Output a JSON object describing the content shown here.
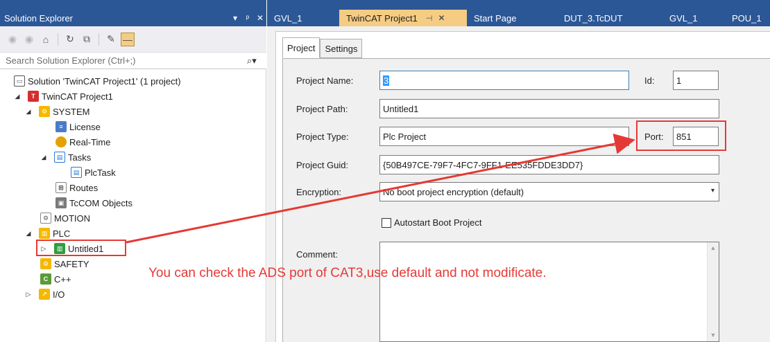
{
  "solution_explorer": {
    "title": "Solution Explorer",
    "title_buttons": [
      "▾",
      "ᵖ",
      "✕"
    ],
    "search_placeholder": "Search Solution Explorer (Ctrl+;)",
    "tree": {
      "solution": "Solution 'TwinCAT Project1' (1 project)",
      "project": "TwinCAT Project1",
      "system": "SYSTEM",
      "license": "License",
      "realtime": "Real-Time",
      "tasks": "Tasks",
      "plctask": "PlcTask",
      "routes": "Routes",
      "tcom": "TcCOM Objects",
      "motion": "MOTION",
      "plc": "PLC",
      "untitled1": "Untitled1",
      "safety": "SAFETY",
      "cpp": "C++",
      "io": "I/O"
    }
  },
  "doc_tabs": [
    {
      "label": "GVL_1"
    },
    {
      "label": "TwinCAT Project1"
    },
    {
      "label": "Start Page"
    },
    {
      "label": "DUT_3.TcDUT"
    },
    {
      "label": "GVL_1"
    },
    {
      "label": "POU_1"
    }
  ],
  "sub_tabs": [
    "Project",
    "Settings"
  ],
  "form": {
    "project_name_label": "Project Name:",
    "project_name_value": "3",
    "id_label": "Id:",
    "id_value": "1",
    "project_path_label": "Project Path:",
    "project_path_value": "Untitled1",
    "project_type_label": "Project Type:",
    "project_type_value": "Plc Project",
    "port_label": "Port:",
    "port_value": "851",
    "project_guid_label": "Project Guid:",
    "project_guid_value": "{50B497CE-79F7-4FC7-9FF1-EE535FDDE3DD7}",
    "encryption_label": "Encryption:",
    "encryption_value": "No boot project encryption (default)",
    "autostart_label": "Autostart Boot Project",
    "comment_label": "Comment:"
  },
  "annotation": "You can check the ADS port of CAT3,use default and not modificate.",
  "colors": {
    "title_bar": "#2b5797",
    "active_tab": "#f5cc84",
    "highlight_red": "#e53935",
    "selection_blue": "#3399ff"
  }
}
